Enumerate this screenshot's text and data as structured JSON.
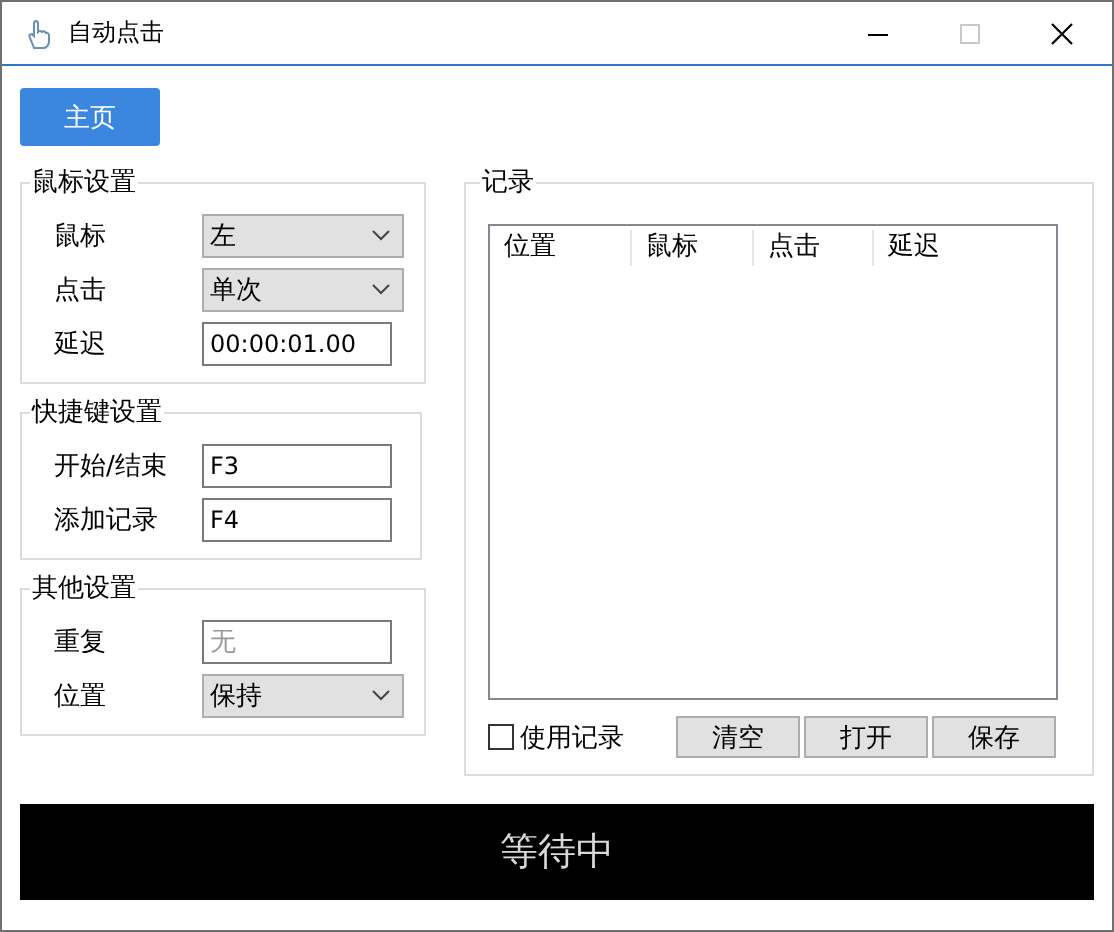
{
  "window": {
    "title": "自动点击"
  },
  "home_button": "主页",
  "groups": [
    {
      "title": "鼠标设置",
      "rows": [
        {
          "kind": "select",
          "label": "鼠标",
          "value": "左"
        },
        {
          "kind": "select",
          "label": "点击",
          "value": "单次"
        },
        {
          "kind": "input",
          "label": "延迟",
          "value": "00:00:01.00"
        }
      ]
    },
    {
      "title": "快捷键设置",
      "rows": [
        {
          "kind": "input",
          "label": "开始/结束",
          "value": "F3"
        },
        {
          "kind": "input",
          "label": "添加记录",
          "value": "F4"
        }
      ]
    },
    {
      "title": "其他设置",
      "rows": [
        {
          "kind": "input",
          "label": "重复",
          "placeholder": "无"
        },
        {
          "kind": "select",
          "label": "位置",
          "value": "保持"
        }
      ]
    }
  ],
  "records": {
    "title": "记录",
    "columns": [
      "位置",
      "鼠标",
      "点击",
      "延迟"
    ],
    "use_records": {
      "label": "使用记录",
      "checked": false
    },
    "buttons": [
      "清空",
      "打开",
      "保存"
    ]
  },
  "status": "等待中"
}
